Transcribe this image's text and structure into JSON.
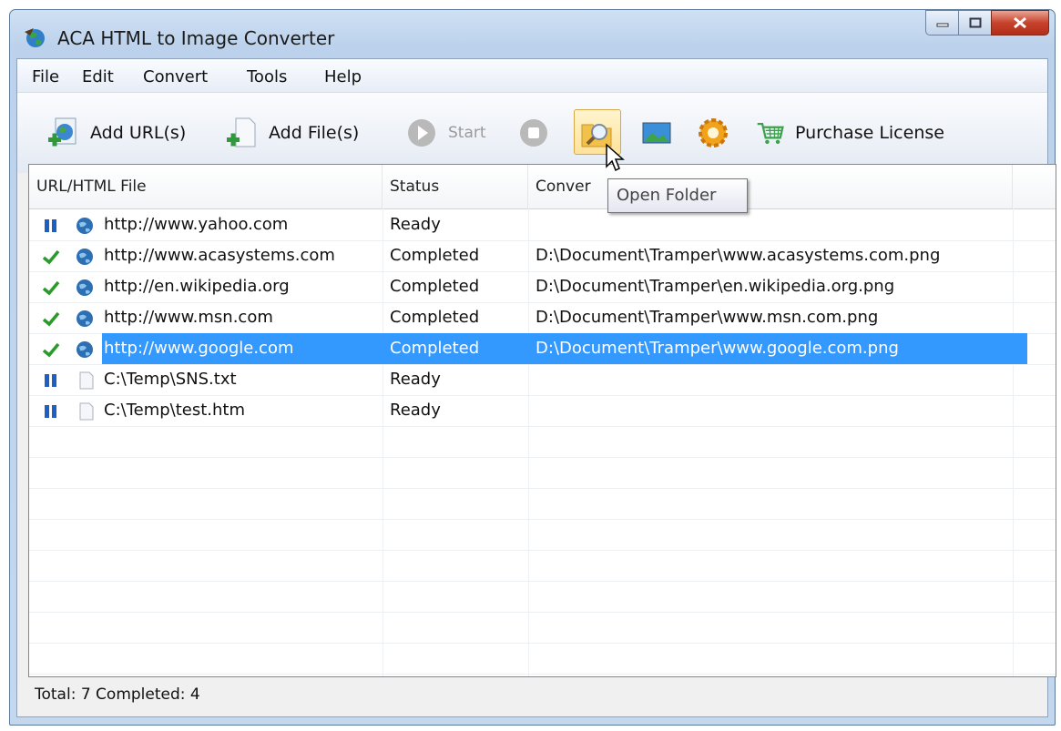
{
  "window": {
    "title": "ACA HTML to Image Converter"
  },
  "menu": [
    "File",
    "Edit",
    "Convert",
    "Tools",
    "Help"
  ],
  "toolbar": {
    "add_url": "Add URL(s)",
    "add_file": "Add File(s)",
    "start": "Start",
    "purchase": "Purchase License",
    "icons": [
      "add-url-icon",
      "add-file-icon",
      "start-icon",
      "stop-icon",
      "open-folder-icon",
      "image-settings-icon",
      "options-gear-icon",
      "purchase-cart-icon"
    ]
  },
  "table": {
    "columns": [
      "URL/HTML File",
      "Status",
      "Conver"
    ],
    "rows": [
      {
        "state": "paused",
        "type": "url",
        "file": "http://www.yahoo.com",
        "status": "Ready",
        "output": ""
      },
      {
        "state": "done",
        "type": "url",
        "file": "http://www.acasystems.com",
        "status": "Completed",
        "output": "D:\\Document\\Tramper\\www.acasystems.com.png"
      },
      {
        "state": "done",
        "type": "url",
        "file": "http://en.wikipedia.org",
        "status": "Completed",
        "output": "D:\\Document\\Tramper\\en.wikipedia.org.png"
      },
      {
        "state": "done",
        "type": "url",
        "file": "http://www.msn.com",
        "status": "Completed",
        "output": "D:\\Document\\Tramper\\www.msn.com.png"
      },
      {
        "state": "done",
        "type": "url",
        "file": "http://www.google.com",
        "status": "Completed",
        "output": "D:\\Document\\Tramper\\www.google.com.png",
        "selected": true
      },
      {
        "state": "paused",
        "type": "file",
        "file": "C:\\Temp\\SNS.txt",
        "status": "Ready",
        "output": ""
      },
      {
        "state": "paused",
        "type": "file",
        "file": "C:\\Temp\\test.htm",
        "status": "Ready",
        "output": ""
      }
    ]
  },
  "tooltip": {
    "text": "Open Folder"
  },
  "statusbar": {
    "text": "Total: 7 Completed: 4"
  },
  "colors": {
    "selection": "#3399ff",
    "check": "#2a9a2a",
    "pause": "#1e5fc4"
  }
}
